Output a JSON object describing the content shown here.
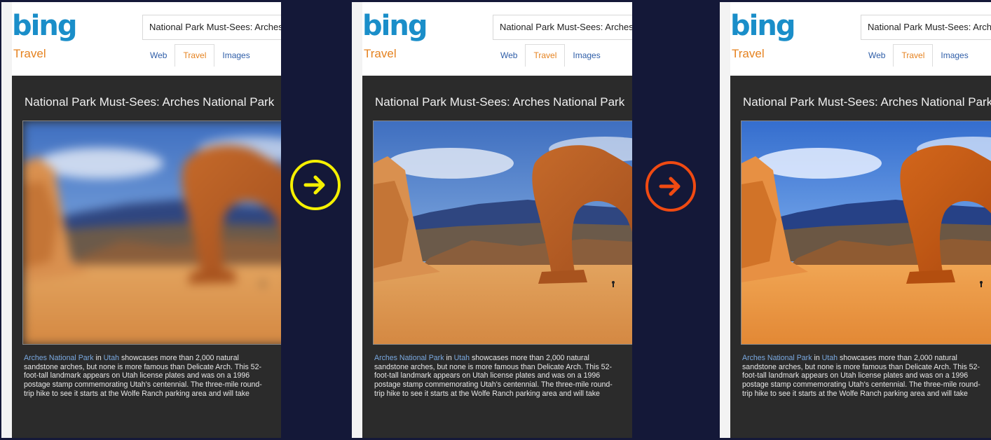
{
  "panels": [
    {
      "state": "blurred",
      "logo": "bing",
      "vertical": "Travel",
      "search_value": "National Park Must-Sees: Arches National Park",
      "tabs": [
        {
          "label": "Web"
        },
        {
          "label": "Travel",
          "active": true
        },
        {
          "label": "Images"
        }
      ],
      "article": {
        "title": "National Park Must-Sees: Arches National Park",
        "link1": "Arches National Park",
        "in": " in ",
        "link2": "Utah",
        "body": " showcases more than 2,000 natural sandstone arches, but none is more famous than Delicate Arch. This 52-foot-tall landmark appears on Utah license plates and was on a 1996 postage stamp commemorating Utah's centennial. The three-mile round-trip hike to see it starts at the Wolfe Ranch parking area and will take"
      }
    },
    {
      "state": "sharp",
      "logo": "bing",
      "vertical": "Travel",
      "search_value": "National Park Must-Sees: Arches National Park",
      "tabs": [
        {
          "label": "Web"
        },
        {
          "label": "Travel",
          "active": true
        },
        {
          "label": "Images"
        }
      ],
      "article": {
        "title": "National Park Must-Sees: Arches National Park",
        "link1": "Arches National Park",
        "in": " in ",
        "link2": "Utah",
        "body": " showcases more than 2,000 natural sandstone arches, but none is more famous than Delicate Arch. This 52-foot-tall landmark appears on Utah license plates and was on a 1996 postage stamp commemorating Utah's centennial. The three-mile round-trip hike to see it starts at the Wolfe Ranch parking area and will take"
      }
    },
    {
      "state": "sharp",
      "logo": "bing",
      "vertical": "Travel",
      "search_value": "National Park Must-Sees: Arches National Park",
      "tabs": [
        {
          "label": "Web"
        },
        {
          "label": "Travel",
          "active": true
        },
        {
          "label": "Images"
        }
      ],
      "article": {
        "title": "National Park Must-Sees: Arches National Park",
        "link1": "Arches National Park",
        "in": " in ",
        "link2": "Utah",
        "body": " showcases more than 2,000 natural sandstone arches, but none is more famous than Delicate Arch. This 52-foot-tall landmark appears on Utah license plates and was on a 1996 postage stamp commemorating Utah's centennial. The three-mile round-trip hike to see it starts at the Wolfe Ranch parking area and will take"
      }
    }
  ],
  "arrows": [
    {
      "icon": "arrow-right-icon",
      "color": "#f5f000"
    },
    {
      "icon": "arrow-right-icon",
      "color": "#f04a12"
    }
  ]
}
